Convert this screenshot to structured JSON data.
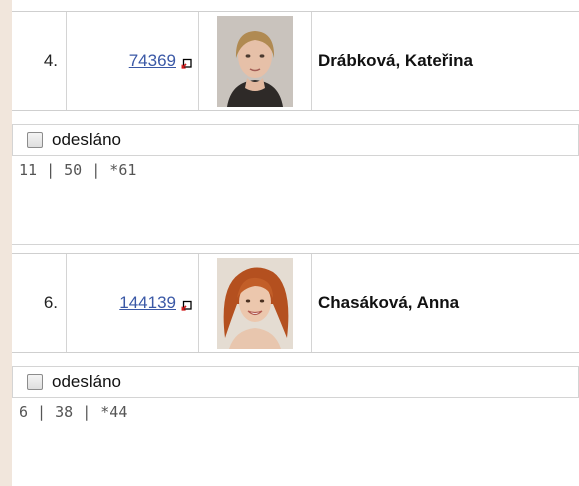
{
  "records": [
    {
      "number": "4.",
      "id": "74369",
      "name": "Drábková, Kateřina",
      "checkbox_label": "odesláno",
      "notes": "11 | 50 | *61"
    },
    {
      "number": "6.",
      "id": "144139",
      "name": "Chasáková, Anna",
      "checkbox_label": "odesláno",
      "notes": "6 | 38 | *44"
    }
  ],
  "colors": {
    "background": "#f1e6dc",
    "link": "#3a58a6",
    "border": "#d4d4d4"
  },
  "icons": [
    "external-link-icon",
    "checkbox"
  ]
}
